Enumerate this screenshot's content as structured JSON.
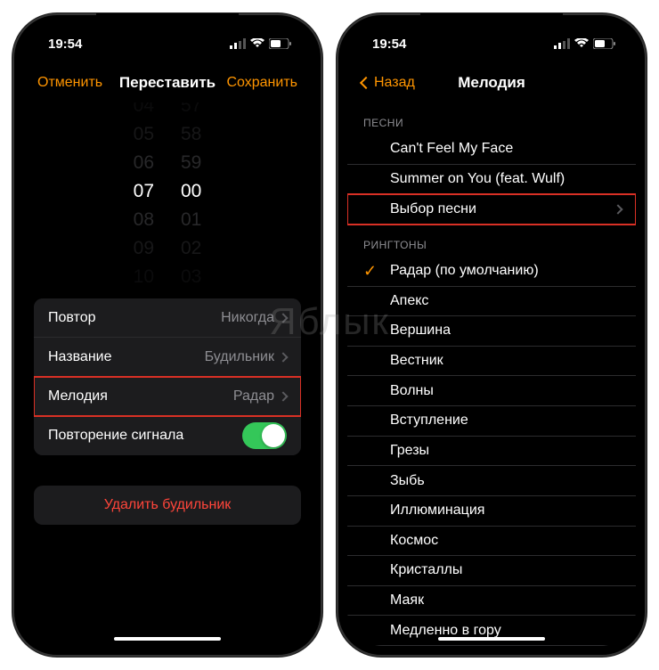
{
  "status": {
    "time": "19:54"
  },
  "left": {
    "nav": {
      "cancel": "Отменить",
      "title": "Переставить",
      "save": "Сохранить"
    },
    "picker": {
      "hours": [
        "04",
        "05",
        "06",
        "07",
        "08",
        "09",
        "10"
      ],
      "minutes": [
        "57",
        "58",
        "59",
        "00",
        "01",
        "02",
        "03"
      ],
      "sel_h": "07",
      "sel_m": "00"
    },
    "rows": {
      "repeat_label": "Повтор",
      "repeat_value": "Никогда",
      "name_label": "Название",
      "name_value": "Будильник",
      "sound_label": "Мелодия",
      "sound_value": "Радар",
      "snooze_label": "Повторение сигнала"
    },
    "delete": "Удалить будильник"
  },
  "right": {
    "nav": {
      "back": "Назад",
      "title": "Мелодия"
    },
    "songs_header": "ПЕСНИ",
    "songs": [
      "Can't Feel My Face",
      "Summer on You (feat. Wulf)",
      "Выбор песни"
    ],
    "tones_header": "РИНГТОНЫ",
    "tones": [
      "Радар (по умолчанию)",
      "Апекс",
      "Вершина",
      "Вестник",
      "Волны",
      "Вступление",
      "Грезы",
      "Зыбь",
      "Иллюминация",
      "Космос",
      "Кристаллы",
      "Маяк",
      "Медленно в гору"
    ]
  },
  "watermark": "Яблык"
}
